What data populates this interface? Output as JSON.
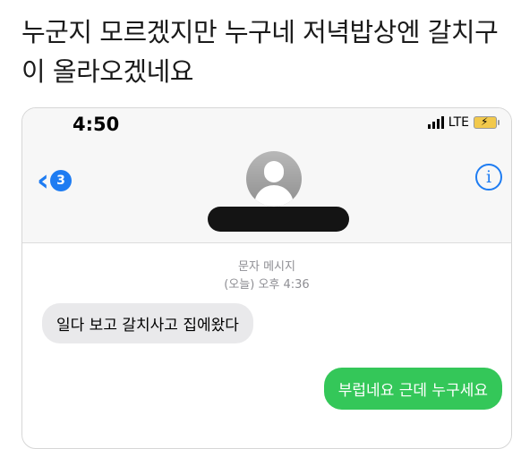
{
  "post": {
    "caption": "누군지 모르겠지만 누구네 저녁밥상엔 갈치구이 올라오겠네요"
  },
  "status_bar": {
    "time": "4:50",
    "network": "LTE"
  },
  "header": {
    "unread_count": "3",
    "info_glyph": "i"
  },
  "conversation": {
    "message_type": "문자 메시지",
    "timestamp": "(오늘) 오후 4:36",
    "messages": [
      {
        "direction": "received",
        "text": "일다 보고 갈치사고 집에왔다"
      },
      {
        "direction": "sent",
        "text": "부럽네요 근데 누구세요"
      }
    ]
  },
  "colors": {
    "accent": "#1e7cf2",
    "sent_bubble": "#34c759",
    "received_bubble": "#e9e9eb",
    "battery": "#f2c94c"
  },
  "icons": [
    "signal-icon",
    "battery-icon",
    "back-chevron-icon",
    "avatar-placeholder-icon",
    "info-icon"
  ]
}
